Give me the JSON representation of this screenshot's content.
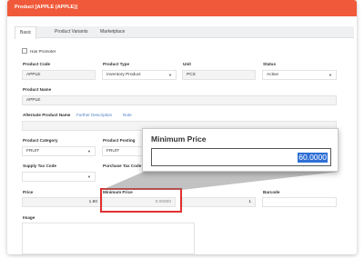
{
  "modal": {
    "title": "Product [APPLE (APPLE)]"
  },
  "tabs": [
    "Basic",
    "Product Variants",
    "Marketplace"
  ],
  "has_promoter": {
    "label": "Has Promoter"
  },
  "product_code": {
    "label": "Product Code",
    "value": "APPLE"
  },
  "product_type": {
    "label": "Product Type",
    "value": "Inventory Product"
  },
  "unit": {
    "label": "Unit",
    "value": "PCS"
  },
  "status": {
    "label": "Status",
    "value": "Active"
  },
  "product_name": {
    "label": "Product Name",
    "value": "APPLE"
  },
  "alternate_name": {
    "label": "Alternate Product Name",
    "further": "Further Description",
    "note": "Note"
  },
  "category": {
    "label": "Product Category",
    "value": "FRUIT"
  },
  "posting": {
    "label": "Product Posting",
    "value": "FRUIT"
  },
  "supply_tax": {
    "label": "Supply Tax Code",
    "value": ""
  },
  "purchase_tax": {
    "label": "Purchase Tax Code"
  },
  "price": {
    "label": "Price",
    "value": "1.80"
  },
  "min_price": {
    "label": "Minimum Price",
    "value": "0.00000"
  },
  "third_value": "1",
  "barcode": {
    "label": "Barcode"
  },
  "image": {
    "label": "Image"
  },
  "popup": {
    "title": "Minimum Price",
    "value": "60.0000"
  },
  "colors": {
    "header": "#f05a3a",
    "highlight": "#e03030",
    "selection": "#2f6fd6"
  }
}
